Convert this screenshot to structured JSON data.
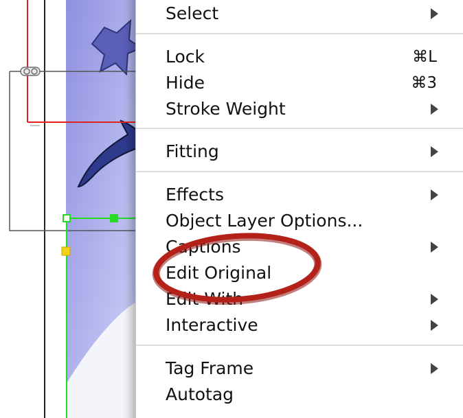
{
  "menu": {
    "groups": [
      {
        "items": [
          {
            "label": "Select",
            "shortcut": "",
            "submenu": true
          }
        ]
      },
      {
        "items": [
          {
            "label": "Lock",
            "shortcut": "⌘L",
            "submenu": false
          },
          {
            "label": "Hide",
            "shortcut": "⌘3",
            "submenu": false
          },
          {
            "label": "Stroke Weight",
            "shortcut": "",
            "submenu": true
          }
        ]
      },
      {
        "items": [
          {
            "label": "Fitting",
            "shortcut": "",
            "submenu": true
          }
        ]
      },
      {
        "items": [
          {
            "label": "Effects",
            "shortcut": "",
            "submenu": true
          },
          {
            "label": "Object Layer Options...",
            "shortcut": "",
            "submenu": false
          },
          {
            "label": "Captions",
            "shortcut": "",
            "submenu": true
          },
          {
            "label": "Edit Original",
            "shortcut": "",
            "submenu": false
          },
          {
            "label": "Edit With",
            "shortcut": "",
            "submenu": true
          },
          {
            "label": "Interactive",
            "shortcut": "",
            "submenu": true
          }
        ]
      },
      {
        "items": [
          {
            "label": "Tag Frame",
            "shortcut": "",
            "submenu": true
          },
          {
            "label": "Autotag",
            "shortcut": "",
            "submenu": false
          }
        ]
      }
    ],
    "highlighted_item": "Edit Original"
  },
  "colors": {
    "annotation_ring": "#a8201a",
    "frame_guide_red": "#e02020",
    "selection_green": "#22dd22",
    "image_blue": "#a6a6e8",
    "star_blue": "#5a5fb8",
    "swoosh_navy": "#2e3a8c"
  }
}
